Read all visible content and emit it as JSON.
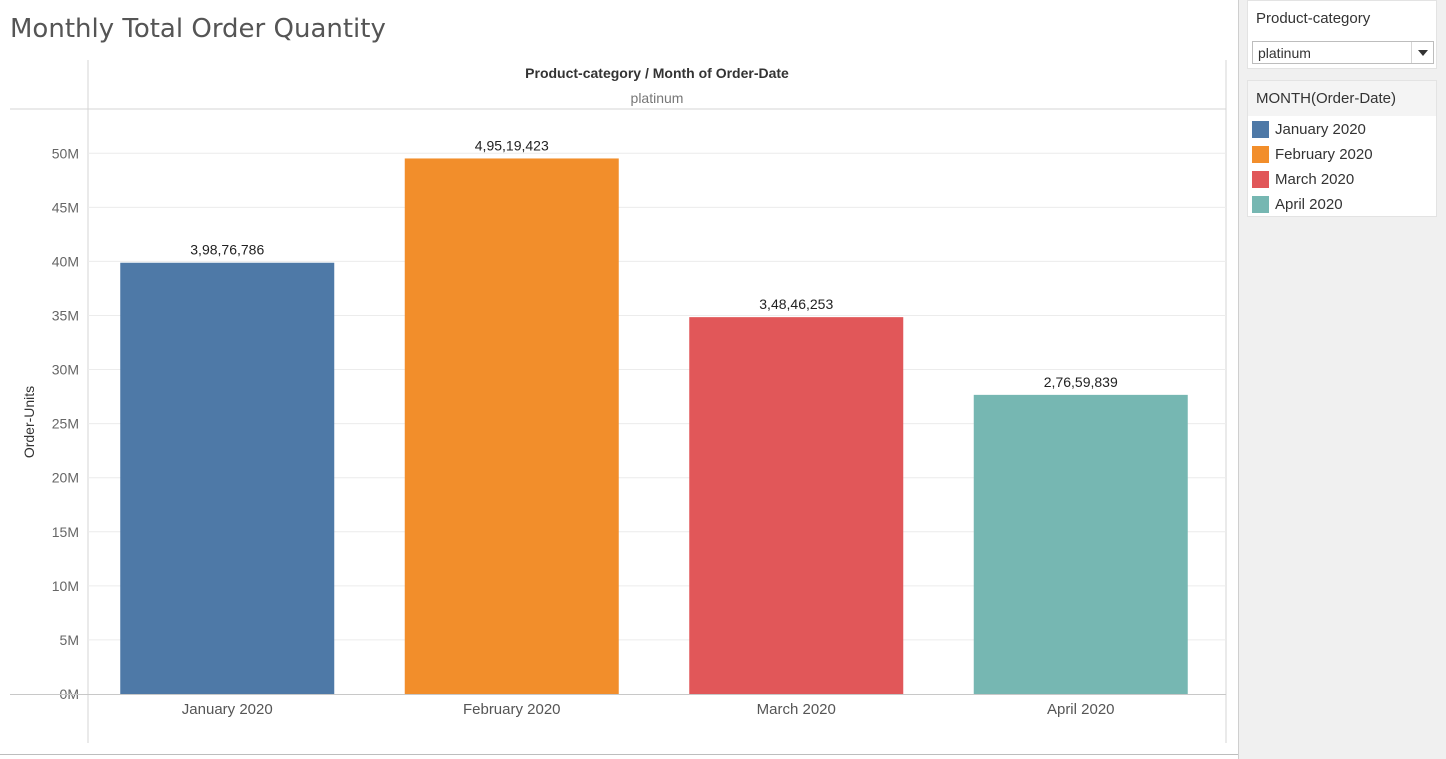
{
  "dashboard": {
    "title": "Monthly Total Order Quantity"
  },
  "chart_data": {
    "type": "bar",
    "header": "Product-category  /  Month of Order-Date",
    "pane_label": "platinum",
    "ylabel": "Order-Units",
    "xlabel": "",
    "ylim": [
      0,
      54000000
    ],
    "y_ticks": [
      0,
      5000000,
      10000000,
      15000000,
      20000000,
      25000000,
      30000000,
      35000000,
      40000000,
      45000000,
      50000000
    ],
    "y_tick_labels": [
      "0M",
      "5M",
      "10M",
      "15M",
      "20M",
      "25M",
      "30M",
      "35M",
      "40M",
      "45M",
      "50M"
    ],
    "categories": [
      "January 2020",
      "February 2020",
      "March 2020",
      "April 2020"
    ],
    "values": [
      39876786,
      49519423,
      34846253,
      27659839
    ],
    "value_labels": [
      "3,98,76,786",
      "4,95,19,423",
      "3,48,46,253",
      "2,76,59,839"
    ],
    "colors": [
      "#4e79a7",
      "#f28e2b",
      "#e15759",
      "#76b7b2"
    ],
    "grid": true
  },
  "filter": {
    "title": "Product-category",
    "selected": "platinum"
  },
  "legend": {
    "title": "MONTH(Order-Date)",
    "items": [
      {
        "label": "January 2020",
        "color": "#4e79a7"
      },
      {
        "label": "February 2020",
        "color": "#f28e2b"
      },
      {
        "label": "March 2020",
        "color": "#e15759"
      },
      {
        "label": "April 2020",
        "color": "#76b7b2"
      }
    ]
  }
}
